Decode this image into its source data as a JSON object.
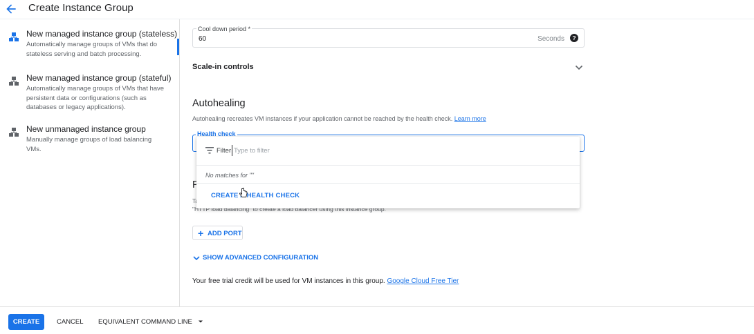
{
  "header": {
    "title": "Create Instance Group"
  },
  "sidebar": {
    "items": [
      {
        "title": "New managed instance group (stateless)",
        "desc": "Automatically manage groups of VMs that do stateless serving and batch processing."
      },
      {
        "title": "New managed instance group (stateful)",
        "desc": "Automatically manage groups of VMs that have persistent data or configurations (such as databases or legacy applications)."
      },
      {
        "title": "New unmanaged instance group",
        "desc": "Manually manage groups of load balancing VMs."
      }
    ]
  },
  "cooldown": {
    "label": "Cool down period *",
    "value": "60",
    "suffix": "Seconds"
  },
  "scale_in": {
    "label": "Scale-in controls"
  },
  "autohealing": {
    "title": "Autohealing",
    "desc": "Autohealing recreates VM instances if your application cannot be reached by the health check.",
    "learn_more": "Learn more",
    "health_check_label": "Health check"
  },
  "behind": {
    "p": "P",
    "t1": "Ta",
    "t2": "\"HTTP load balancing\" to create a load balancer using this instance group."
  },
  "dropdown": {
    "filter_label": "Filter",
    "filter_placeholder": "Type to filter",
    "no_matches": "No matches for \"\"",
    "create_health_check": "CREATE A HEALTH CHECK"
  },
  "add_port": {
    "label": "ADD PORT"
  },
  "advanced": {
    "label": "SHOW ADVANCED CONFIGURATION"
  },
  "credit": {
    "text": "Your free trial credit will be used for VM instances in this group.",
    "link": "Google Cloud Free Tier"
  },
  "footer": {
    "create": "CREATE",
    "cancel": "CANCEL",
    "command_line": "EQUIVALENT COMMAND LINE"
  },
  "colors": {
    "accent": "#1a73e8"
  }
}
